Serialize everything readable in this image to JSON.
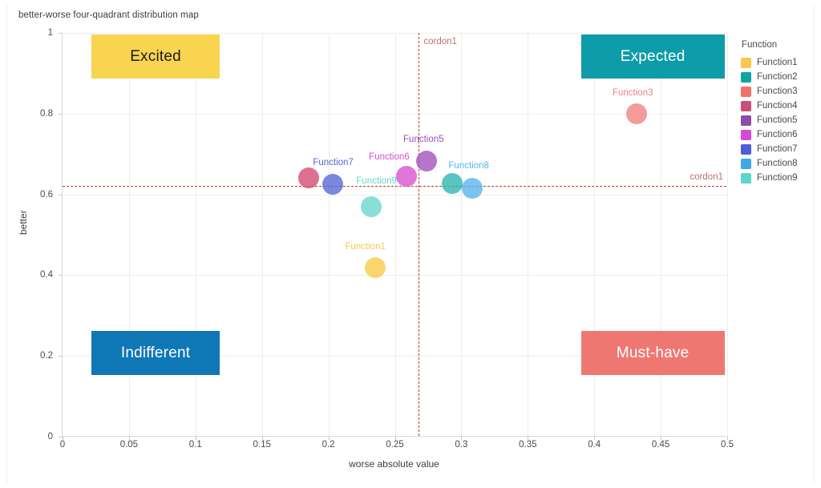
{
  "chart_data": {
    "type": "scatter",
    "title": "better-worse four-quadrant distribution map",
    "xlabel": "worse absolute value",
    "ylabel": "better",
    "xlim": [
      0,
      0.5
    ],
    "ylim": [
      0,
      1
    ],
    "xticks": [
      "0",
      "0.05",
      "0.1",
      "0.15",
      "0.2",
      "0.25",
      "0.3",
      "0.35",
      "0.4",
      "0.45",
      "0.5"
    ],
    "xtick_values": [
      0,
      0.05,
      0.1,
      0.15,
      0.2,
      0.25,
      0.3,
      0.35,
      0.4,
      0.45,
      0.5
    ],
    "yticks": [
      "0",
      "0.2",
      "0.4",
      "0.6",
      "0.8",
      "1"
    ],
    "ytick_values": [
      0,
      0.2,
      0.4,
      0.6,
      0.8,
      1
    ],
    "grid": true,
    "legend_position": "right",
    "legend_title": "Function",
    "series": [
      {
        "name": "Function1",
        "x": 0.235,
        "y": 0.418,
        "color": "#f7c948",
        "label": "Function1",
        "label_dx": -12,
        "label_dy": -26
      },
      {
        "name": "Function2",
        "x": 0.293,
        "y": 0.627,
        "color": "#2bb3ae",
        "label": "",
        "label_dx": 0,
        "label_dy": -24
      },
      {
        "name": "Function3",
        "x": 0.432,
        "y": 0.8,
        "color": "#f08080",
        "label": "Function3",
        "label_dx": -5,
        "label_dy": -26
      },
      {
        "name": "Function4",
        "x": 0.185,
        "y": 0.64,
        "color": "#d4496f",
        "label": "",
        "label_dx": 0,
        "label_dy": -24
      },
      {
        "name": "Function5",
        "x": 0.274,
        "y": 0.683,
        "color": "#a04fbb",
        "label": "Function5",
        "label_dx": -4,
        "label_dy": -27
      },
      {
        "name": "Function6",
        "x": 0.259,
        "y": 0.645,
        "color": "#d64fd0",
        "label": "Function6",
        "label_dx": -22,
        "label_dy": -24
      },
      {
        "name": "Function7",
        "x": 0.203,
        "y": 0.625,
        "color": "#5567d6",
        "label": "Function7",
        "label_dx": 1,
        "label_dy": -27
      },
      {
        "name": "Function8",
        "x": 0.308,
        "y": 0.615,
        "color": "#56b4ea",
        "label": "Function8",
        "label_dx": -4,
        "label_dy": -28
      },
      {
        "name": "Function9",
        "x": 0.232,
        "y": 0.57,
        "color": "#68d5cd",
        "label": "Function9",
        "label_dx": 7,
        "label_dy": -32
      }
    ],
    "reference_lines": [
      {
        "orientation": "vertical",
        "value": 0.268,
        "label": "cordon1",
        "color": "#c0392b"
      },
      {
        "orientation": "horizontal",
        "value": 0.622,
        "label": "cordon1",
        "color": "#c0392b"
      }
    ],
    "annotations": [
      {
        "text": "Excited",
        "x0": 0.022,
        "x1": 0.118,
        "y0": 0.886,
        "y1": 0.996,
        "fill": "#F8D450",
        "text_color": "#1b1b1b"
      },
      {
        "text": "Expected",
        "x0": 0.39,
        "x1": 0.498,
        "y0": 0.886,
        "y1": 0.996,
        "fill": "#0E9CA8",
        "text_color": "#ffffff"
      },
      {
        "text": "Indifferent",
        "x0": 0.022,
        "x1": 0.118,
        "y0": 0.152,
        "y1": 0.262,
        "fill": "#1077B6",
        "text_color": "#ffffff"
      },
      {
        "text": "Must-have",
        "x0": 0.39,
        "x1": 0.498,
        "y0": 0.152,
        "y1": 0.262,
        "fill": "#EF7772",
        "text_color": "#ffffff"
      }
    ]
  },
  "legend": {
    "title": "Function",
    "items": [
      {
        "label": "Function1",
        "color": "#F9C74F"
      },
      {
        "label": "Function2",
        "color": "#0FA3A3"
      },
      {
        "label": "Function3",
        "color": "#F0726B"
      },
      {
        "label": "Function4",
        "color": "#C94F78"
      },
      {
        "label": "Function5",
        "color": "#8E4BA8"
      },
      {
        "label": "Function6",
        "color": "#D54BD4"
      },
      {
        "label": "Function7",
        "color": "#4C5FD7"
      },
      {
        "label": "Function8",
        "color": "#3FA9E8"
      },
      {
        "label": "Function9",
        "color": "#5FD6CB"
      }
    ]
  }
}
